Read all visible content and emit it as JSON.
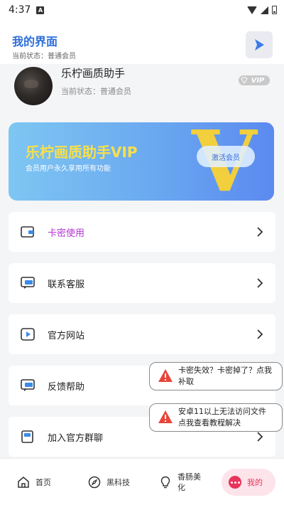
{
  "status_bar": {
    "time": "4:37",
    "notif_letter": "A"
  },
  "header": {
    "title": "我的界面",
    "subtitle": "当前状态：普通会员"
  },
  "profile": {
    "name": "乐柠画质助手",
    "status": "当前状态：普通会员",
    "badge": "VIP"
  },
  "banner": {
    "title": "乐柠画质助手VIP",
    "subtitle": "会员用户永久享用所有功能",
    "decor_letter": "V",
    "button": "激活会员"
  },
  "menu": {
    "items": [
      {
        "label": "卡密使用"
      },
      {
        "label": "联系客服"
      },
      {
        "label": "官方网站"
      },
      {
        "label": "反馈帮助"
      },
      {
        "label": "加入官方群聊"
      }
    ]
  },
  "toasts": [
    {
      "line1": "卡密失效？卡密掉了？点我",
      "line2": "补取"
    },
    {
      "line1": "安卓11以上无法访问文件",
      "line2": "点我查看教程解决"
    }
  ],
  "nav": {
    "items": [
      {
        "label": "首页"
      },
      {
        "label": "黑科技"
      },
      {
        "label": "香肠美",
        "label2": "化"
      },
      {
        "label": "我的"
      }
    ]
  },
  "colors": {
    "accent_blue": "#2f6fd8",
    "accent_purple": "#b535d4",
    "active_red": "#e8345a",
    "banner_yellow": "#f7e04a"
  }
}
